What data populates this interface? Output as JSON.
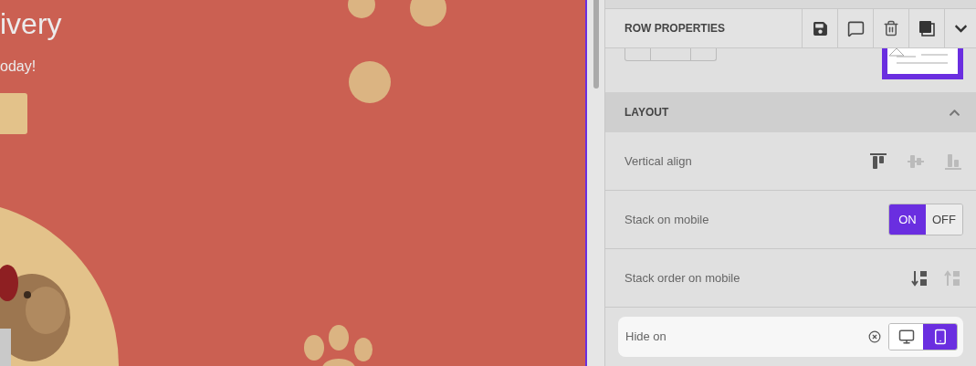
{
  "preview": {
    "heading": "ivery",
    "text": "oday!"
  },
  "panel": {
    "title": "ROW PROPERTIES",
    "section": {
      "title": "LAYOUT",
      "expanded": true
    },
    "rows": [
      {
        "kind": "align",
        "label": "Vertical align",
        "options": [
          {
            "selected": true
          },
          {
            "selected": false
          },
          {
            "selected": false
          }
        ]
      },
      {
        "kind": "toggle",
        "label": "Stack on mobile",
        "options": [
          {
            "label": "ON",
            "selected": true
          },
          {
            "label": "OFF",
            "selected": false
          }
        ]
      },
      {
        "kind": "order",
        "label": "Stack order on mobile",
        "options": [
          {
            "selected": true
          },
          {
            "selected": false
          }
        ]
      },
      {
        "kind": "devices",
        "label": "Hide on",
        "options": [
          {
            "selected": false
          },
          {
            "selected": true
          }
        ]
      }
    ]
  }
}
